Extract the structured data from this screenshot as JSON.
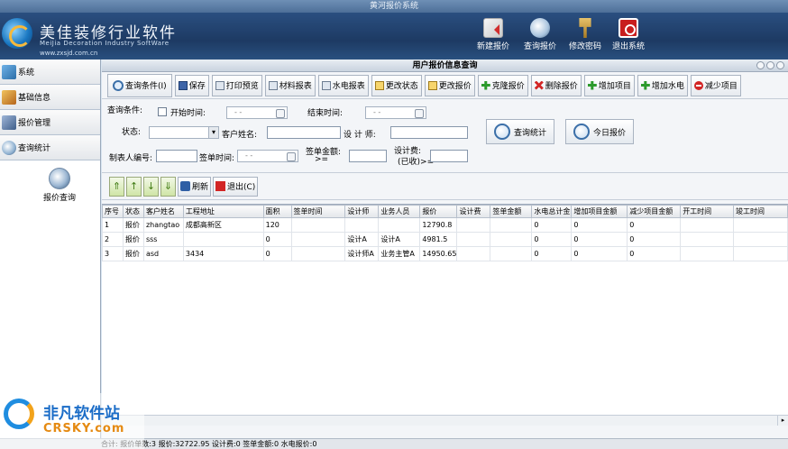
{
  "window": {
    "title": "黄河报价系统"
  },
  "brand": {
    "name_cn": "美佳装修行业软件",
    "name_en": "MeiJia Decoration Industry SoftWare",
    "url": "www.zxsjd.com.cn"
  },
  "top_toolbar": [
    {
      "id": "new",
      "label": "新建报价",
      "icon": "new-quote-icon"
    },
    {
      "id": "query",
      "label": "查询报价",
      "icon": "search-icon"
    },
    {
      "id": "password",
      "label": "修改密码",
      "icon": "key-icon"
    },
    {
      "id": "exit",
      "label": "退出系统",
      "icon": "power-icon"
    }
  ],
  "sidebar": {
    "items": [
      {
        "label": "系统",
        "icon": "system-icon"
      },
      {
        "label": "基础信息",
        "icon": "basic-info-icon"
      },
      {
        "label": "报价管理",
        "icon": "quote-manage-icon"
      },
      {
        "label": "查询统计",
        "icon": "stats-search-icon"
      }
    ],
    "sub_item": {
      "label": "报价查询",
      "icon": "quote-search-icon"
    }
  },
  "panel": {
    "title": "用户报价信息查询"
  },
  "toolbar": {
    "buttons": [
      "查询条件(I)",
      "保存",
      "打印预览",
      "材料报表",
      "水电报表",
      "更改状态",
      "更改报价",
      "克隆报价",
      "删除报价",
      "增加项目",
      "增加水电",
      "减少项目"
    ]
  },
  "filters": {
    "heading": "查询条件:",
    "start_time_label": "开始时间:",
    "start_time_value": "- -",
    "end_time_label": "结束时间:",
    "end_time_value": "- -",
    "status_label": "状态:",
    "customer_label": "客户姓名:",
    "designer_label": "设 计 师:",
    "maker_label": "制表人编号:",
    "sign_time_label": "签单时间:",
    "sign_time_value": "- -",
    "sign_amount_label": "签单金额:",
    "sign_amount_op": ">=",
    "design_fee_label": "设计费:",
    "design_fee_sub": "(已收)>=",
    "stat_button": "查询统计",
    "today_button": "今日报价"
  },
  "navbar": {
    "refresh_label": "刷新",
    "exit_label": "退出(C)"
  },
  "table": {
    "columns": [
      "序号",
      "状态",
      "客户姓名",
      "工程地址",
      "面积",
      "签单时间",
      "设计师",
      "业务人员",
      "报价",
      "设计费",
      "签单金额",
      "水电总计金",
      "增加项目金额",
      "减少项目金额",
      "开工时间",
      "竣工时间"
    ],
    "rows": [
      [
        "1",
        "报价",
        "zhangtao",
        "成都高新区",
        "120",
        "",
        "",
        "",
        "12790.8",
        "",
        "",
        "0",
        "0",
        "0",
        "",
        ""
      ],
      [
        "2",
        "报价",
        "sss",
        "",
        "0",
        "",
        "设计A",
        "设计A",
        "4981.5",
        "",
        "",
        "0",
        "0",
        "0",
        "",
        ""
      ],
      [
        "3",
        "报价",
        "asd",
        "3434",
        "0",
        "",
        "设计师A",
        "业务主管A",
        "14950.65",
        "",
        "",
        "0",
        "0",
        "0",
        "",
        ""
      ]
    ]
  },
  "status": {
    "text": "合计: 报价单数:3 报价:32722.95 设计费:0 签单金额:0 水电报价:0"
  },
  "watermark": {
    "name_cn": "非凡软件站",
    "name_en": "CRSKY.com"
  }
}
